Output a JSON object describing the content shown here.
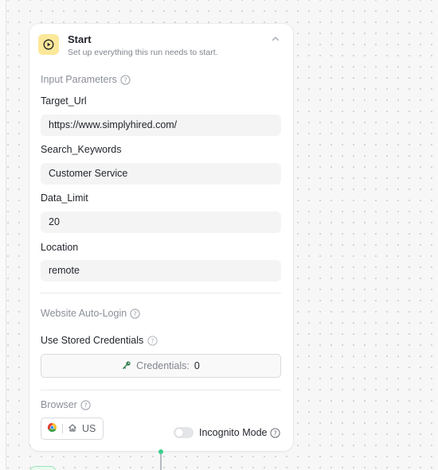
{
  "canvas": {
    "background": "#f7f7f8"
  },
  "node": {
    "title": "Start",
    "subtitle": "Set up everything this run needs to start.",
    "icon": "play-circle-icon",
    "accent": "#fbe89a"
  },
  "input_parameters": {
    "section_label": "Input Parameters",
    "fields": [
      {
        "label": "Target_Url",
        "value": "https://www.simplyhired.com/"
      },
      {
        "label": "Search_Keywords",
        "value": "Customer Service"
      },
      {
        "label": "Data_Limit",
        "value": "20"
      },
      {
        "label": "Location",
        "value": "remote"
      }
    ]
  },
  "auto_login": {
    "section_label": "Website Auto-Login",
    "stored_credentials_label": "Use Stored Credentials",
    "credentials_button_label": "Credentials:",
    "credentials_count": "0",
    "credentials_icon": "key-icon"
  },
  "browser": {
    "section_label": "Browser",
    "chip_icons": [
      "chrome-icon",
      "home-icon"
    ],
    "region": "US",
    "incognito_label": "Incognito Mode",
    "incognito_enabled": false
  },
  "connector": {
    "color": "#3ecf8e"
  }
}
